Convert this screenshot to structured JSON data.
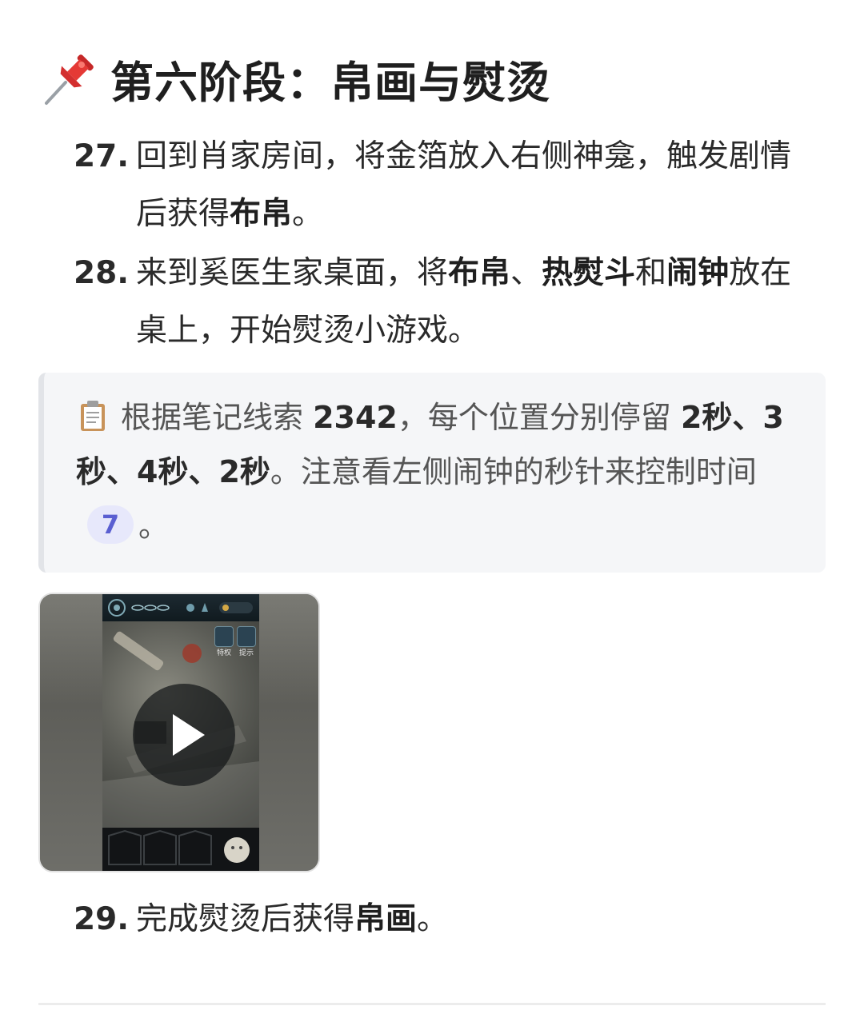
{
  "section": {
    "icon": "pushpin-icon",
    "title": "第六阶段：帛画与熨烫"
  },
  "steps": [
    {
      "number": "27.",
      "text_1": "回到肖家房间，将金箔放入右侧神龛，触发剧情后获得",
      "bold_1": "布帛",
      "text_2": "。"
    },
    {
      "number": "28.",
      "text_1": "来到奚医生家桌面，将",
      "bold_1": "布帛",
      "text_2": "、",
      "bold_2": "热熨斗",
      "text_3": "和",
      "bold_3": "闹钟",
      "text_4": "放在桌上，开始熨烫小游戏。"
    },
    {
      "number": "29.",
      "text_1": "完成熨烫后获得",
      "bold_1": "帛画",
      "text_2": "。"
    }
  ],
  "note": {
    "icon": "clipboard-icon",
    "text_1": "根据笔记线索 ",
    "bold_1": "2342",
    "text_2": "，每个位置分别停留 ",
    "bold_2": "2秒、3秒、4秒、2秒",
    "text_3": "。注意看左侧闹钟的秒针来控制时间",
    "ref_badge": "7",
    "text_4": "。"
  },
  "video": {
    "play_icon": "play-icon",
    "game_buttons": [
      "特权",
      "提示"
    ]
  },
  "colors": {
    "note_background": "#f5f6f8",
    "note_border": "#e2e4e8",
    "badge_background": "#e7e8fb",
    "badge_text": "#5a5fd1"
  }
}
